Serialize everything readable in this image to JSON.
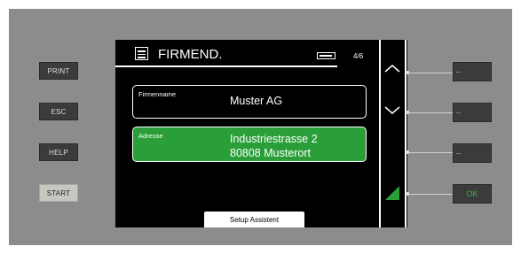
{
  "left_buttons": [
    {
      "label": "PRINT"
    },
    {
      "label": "ESC"
    },
    {
      "label": "HELP"
    },
    {
      "label": "START"
    }
  ],
  "screen": {
    "title": "FIRMEND.",
    "page_indicator": "4/6",
    "icons": {
      "menu": "list-icon",
      "battery": "battery-icon"
    },
    "fields": [
      {
        "label": "Firmenname",
        "value_line1": "Muster AG",
        "value_line2": ""
      },
      {
        "label": "Adresse",
        "value_line1": "Industriestrasse 2",
        "value_line2": "80808 Musterort"
      }
    ],
    "footer_tab": "Setup Assistent",
    "accent_color": "#2a9f39"
  },
  "sidebar": {
    "icons": [
      "chevron-up-icon",
      "chevron-down-icon",
      "",
      "confirm-triangle-icon"
    ]
  },
  "right_buttons": [
    {
      "label": ""
    },
    {
      "label": ""
    },
    {
      "label": ""
    },
    {
      "label": "OK"
    }
  ]
}
